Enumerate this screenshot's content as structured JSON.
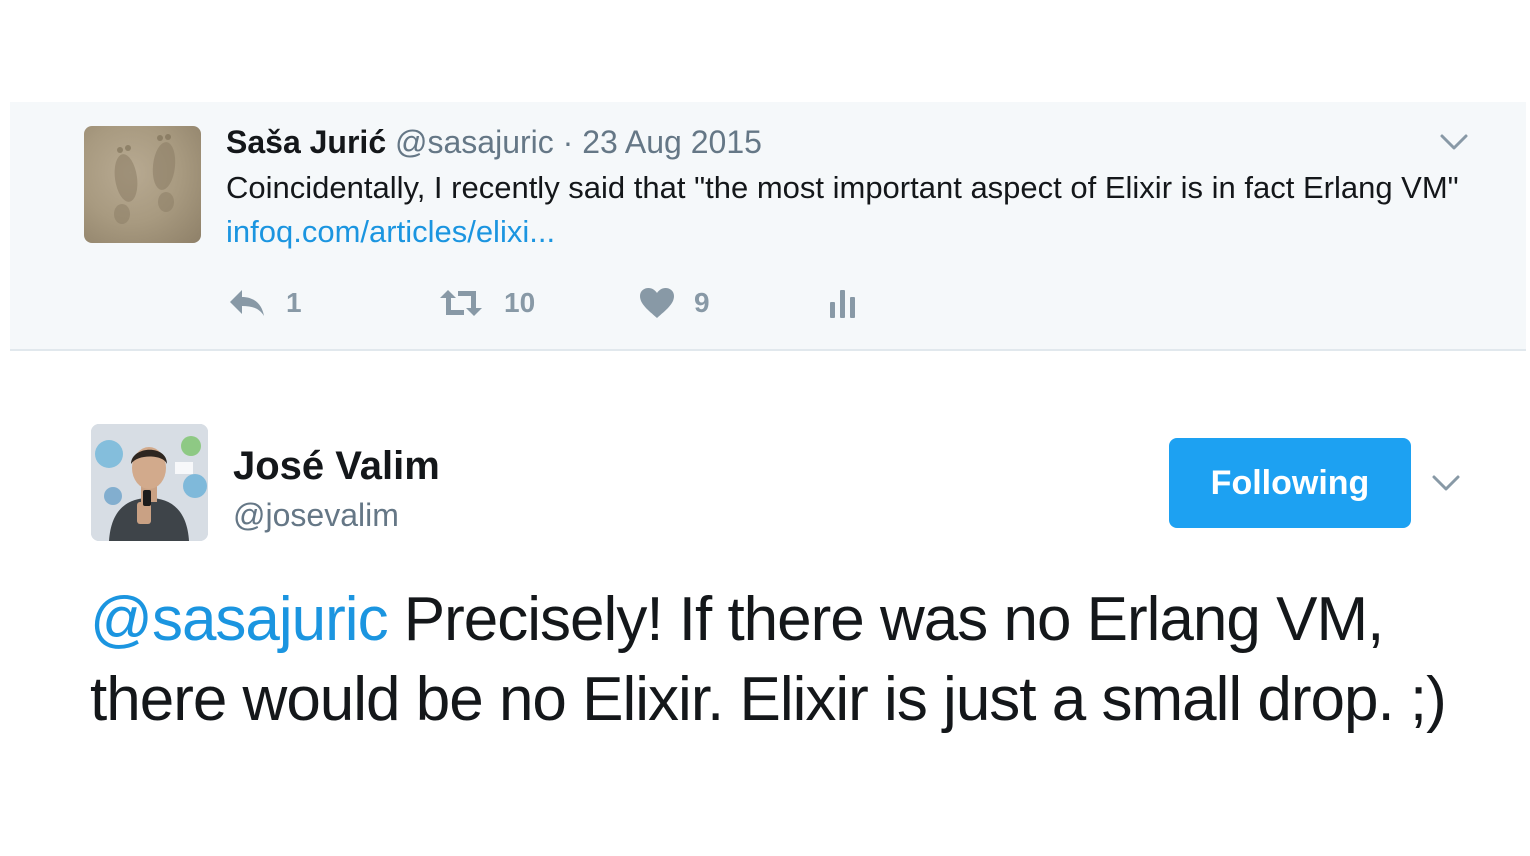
{
  "parent_tweet": {
    "name": "Saša Jurić",
    "handle": "@sasajuric",
    "separator": " · ",
    "date": "23 Aug 2015",
    "text": "Coincidentally, I recently said that \"the most important aspect of Elixir is in fact Erlang VM\" ",
    "link": "infoq.com/articles/elixi...",
    "actions": {
      "reply_count": "1",
      "retweet_count": "10",
      "like_count": "9"
    },
    "icons": [
      "reply-icon",
      "retweet-icon",
      "heart-icon",
      "analytics-icon",
      "chevron-down-icon"
    ]
  },
  "main_tweet": {
    "name": "José Valim",
    "handle": "@josevalim",
    "follow_label": "Following",
    "mention": "@sasajuric",
    "text": " Precisely! If there was no Erlang VM, there would be no Elixir. Elixir is just a small drop. ;)"
  },
  "colors": {
    "accent": "#1da1f2",
    "link": "#1b95e0",
    "muted": "#657786",
    "parent_background": "#f5f8fa"
  }
}
